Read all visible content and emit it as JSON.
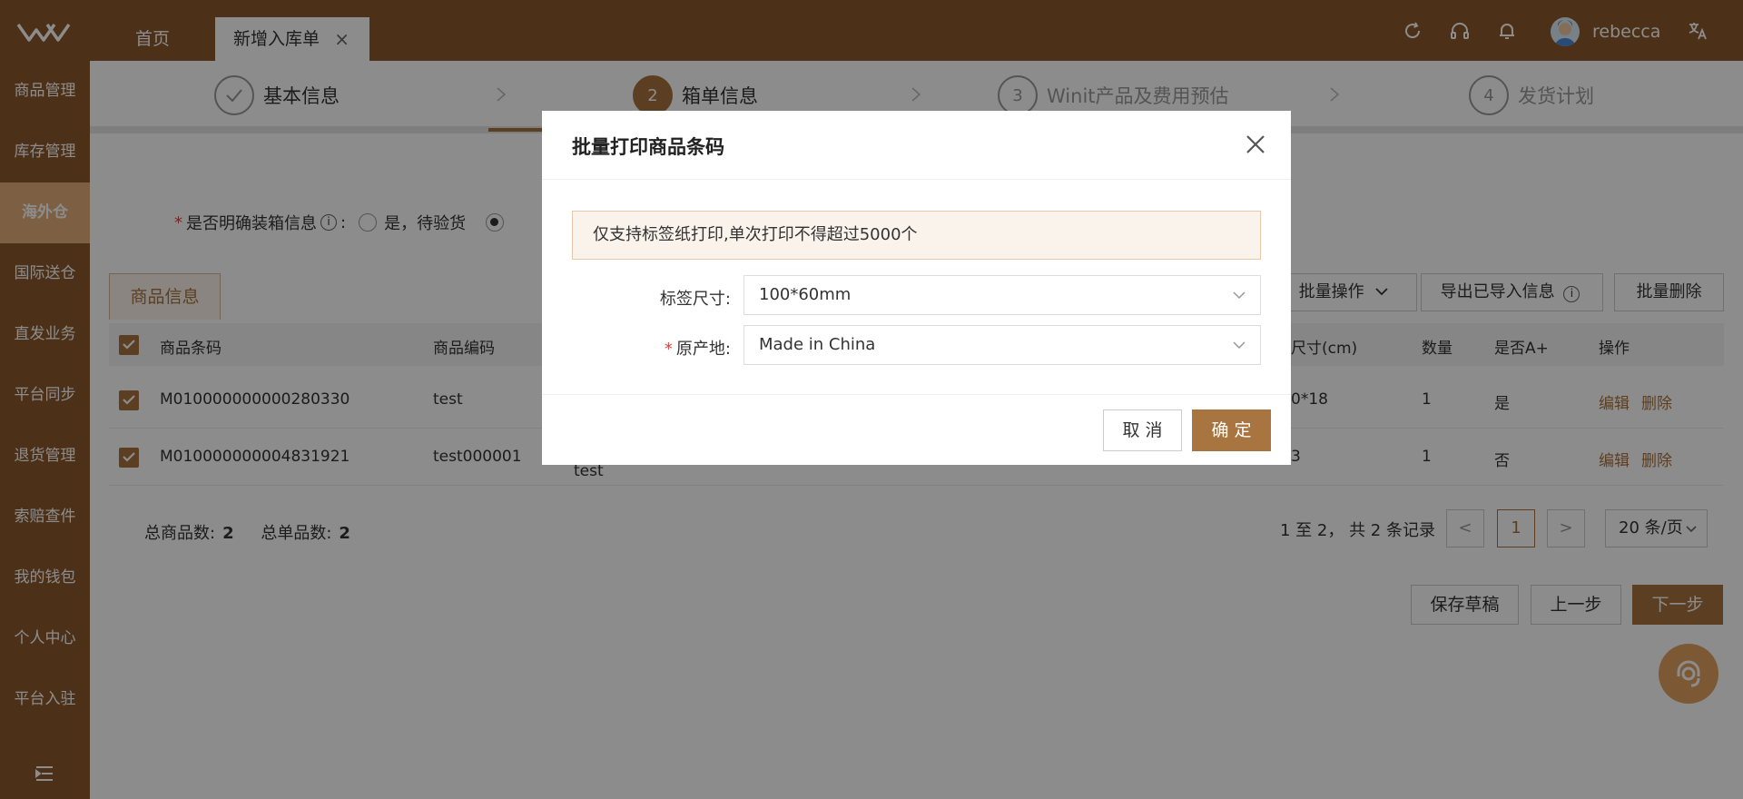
{
  "topbar": {
    "home_tab": "首页",
    "active_tab": "新增入库单",
    "close_glyph": "×",
    "user_name": "rebecca"
  },
  "sidebar": {
    "items": [
      {
        "label": "商品管理"
      },
      {
        "label": "库存管理"
      },
      {
        "label": "海外仓"
      },
      {
        "label": "国际送仓"
      },
      {
        "label": "直发业务"
      },
      {
        "label": "平台同步"
      },
      {
        "label": "退货管理"
      },
      {
        "label": "索赔查件"
      },
      {
        "label": "我的钱包"
      },
      {
        "label": "个人中心"
      },
      {
        "label": "平台入驻"
      }
    ]
  },
  "steps": [
    {
      "num": "",
      "label": "基本信息"
    },
    {
      "num": "2",
      "label": "箱单信息"
    },
    {
      "num": "3",
      "label": "Winit产品及费用预估"
    },
    {
      "num": "4",
      "label": "发货计划"
    }
  ],
  "form": {
    "required_mark": "*",
    "question": "是否明确装箱信息",
    "colon": ":",
    "option_yes": "是，待验货"
  },
  "product_tab": "商品信息",
  "toolbar": {
    "batch_ops": "批量操作",
    "export": "导出已导入信息",
    "batch_delete": "批量删除"
  },
  "table": {
    "headers": [
      "商品条码",
      "商品编码",
      "尺寸(cm)",
      "数量",
      "是否A+",
      "操作"
    ],
    "rows": [
      {
        "barcode": "M010000000000280330",
        "code": "test",
        "size": "0*18",
        "qty": "1",
        "aplus": "是",
        "extra": ""
      },
      {
        "barcode": "M010000000004831921",
        "code": "test000001",
        "size": "3",
        "qty": "1",
        "aplus": "否",
        "extra": "test"
      }
    ],
    "edit": "编辑",
    "delete": "删除"
  },
  "summary": {
    "total_goods_label": "总商品数:",
    "total_goods": "2",
    "total_single_label": "总单品数:",
    "total_single": "2"
  },
  "pager": {
    "text": "1 至 2，  共 2 条记录",
    "prev": "<",
    "page": "1",
    "next": ">",
    "size": "20 条/页"
  },
  "footer": {
    "save_draft": "保存草稿",
    "prev_step": "上一步",
    "next_step": "下一步"
  },
  "modal": {
    "title": "批量打印商品条码",
    "notice": "仅支持标签纸打印,单次打印不得超过5000个",
    "label_size_label": "标签尺寸:",
    "label_size_value": "100*60mm",
    "origin_required": "*",
    "origin_label": "原产地:",
    "origin_value": "Made in China",
    "cancel": "取 消",
    "confirm": "确 定"
  },
  "colors": {
    "brand": "#8a5a2c",
    "accent": "#a8743f",
    "sidebar_active": "#e3b07a"
  }
}
